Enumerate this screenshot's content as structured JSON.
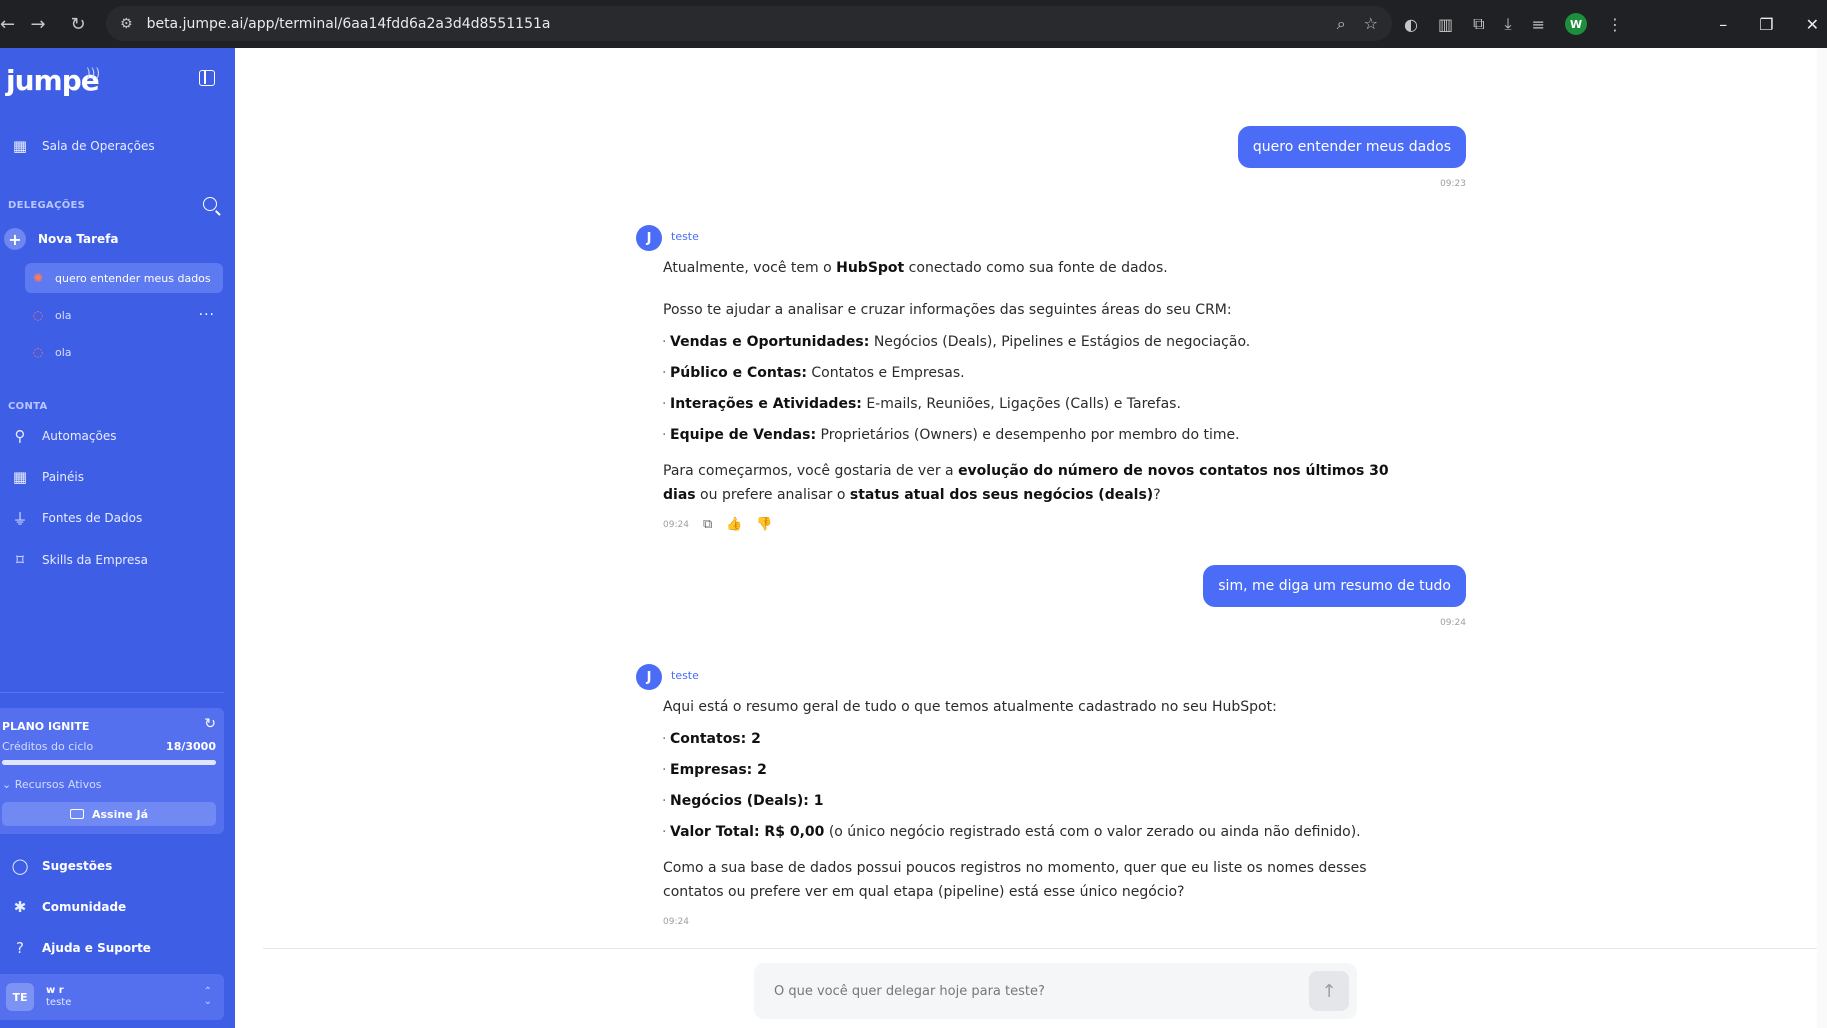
{
  "browser": {
    "url": "beta.jumpe.ai/app/terminal/6aa14fdd6a2a3d4d8551151a",
    "profile_initial": "W"
  },
  "sidebar": {
    "logo": "jumpe",
    "top_items": [
      {
        "label": "Sala de Operações",
        "icon": "grid-icon"
      }
    ],
    "delegations_label": "DELEGAÇÕES",
    "new_task_label": "Nova Tarefa",
    "tasks": [
      {
        "label": "quero entender meus dados",
        "active": true
      },
      {
        "label": "ola",
        "active": false
      },
      {
        "label": "ola",
        "active": false
      }
    ],
    "account_label": "CONTA",
    "account_items": [
      {
        "label": "Automações",
        "icon": "flow-icon"
      },
      {
        "label": "Painéis",
        "icon": "dashboard-icon"
      },
      {
        "label": "Fontes de Dados",
        "icon": "plug-icon"
      },
      {
        "label": "Skills da Empresa",
        "icon": "bookmark-icon"
      }
    ],
    "plan": {
      "title": "PLANO IGNITE",
      "credits_label": "Créditos do ciclo",
      "credits_value": "18/3000",
      "credits_used": 18,
      "credits_total": 3000,
      "resources_label": "Recursos Ativos",
      "cta_label": "Assine Já"
    },
    "bottom_items": [
      {
        "label": "Sugestões",
        "icon": "chat-icon"
      },
      {
        "label": "Comunidade",
        "icon": "slack-icon"
      },
      {
        "label": "Ajuda e Suporte",
        "icon": "help-icon"
      }
    ],
    "user": {
      "initials": "TE",
      "name": "w r",
      "workspace": "teste"
    }
  },
  "chat": {
    "messages": [
      {
        "role": "user",
        "text": "quero entender meus dados",
        "time": "09:23"
      },
      {
        "role": "assistant",
        "name": "teste",
        "time": "09:24",
        "p1_a": "Atualmente, você tem o ",
        "p1_b": "HubSpot",
        "p1_c": " conectado como sua fonte de dados.",
        "p2": "Posso te ajudar a analisar e cruzar informações das seguintes áreas do seu CRM:",
        "bullets": [
          {
            "bold": "Vendas e Oportunidades:",
            "text": " Negócios (Deals), Pipelines e Estágios de negociação."
          },
          {
            "bold": "Público e Contas:",
            "text": " Contatos e Empresas."
          },
          {
            "bold": "Interações e Atividades:",
            "text": " E-mails, Reuniões, Ligações (Calls) e Tarefas."
          },
          {
            "bold": "Equipe de Vendas:",
            "text": " Proprietários (Owners) e desempenho por membro do time."
          }
        ],
        "p3_a": "Para começarmos, você gostaria de ver a ",
        "p3_b": "evolução do número de novos contatos nos últimos 30 dias",
        "p3_c": " ou prefere analisar o ",
        "p3_d": "status atual dos seus negócios (deals)",
        "p3_e": "?"
      },
      {
        "role": "user",
        "text": "sim, me diga um resumo de tudo",
        "time": "09:24"
      },
      {
        "role": "assistant",
        "name": "teste",
        "time": "09:24",
        "p1": "Aqui está o resumo geral de tudo o que temos atualmente cadastrado no seu HubSpot:",
        "bullets": [
          {
            "bold": "Contatos: 2",
            "text": ""
          },
          {
            "bold": "Empresas: 2",
            "text": ""
          },
          {
            "bold": "Negócios (Deals): 1",
            "text": ""
          },
          {
            "bold": "Valor Total: R$ 0,00",
            "text": " (o único negócio registrado está com o valor zerado ou ainda não definido)."
          }
        ],
        "p2": "Como a sua base de dados possui poucos registros no momento, quer que eu liste os nomes desses contatos ou prefere ver em qual etapa (pipeline) está esse único negócio?"
      }
    ]
  },
  "composer": {
    "placeholder": "O que você quer delegar hoje para teste?"
  }
}
